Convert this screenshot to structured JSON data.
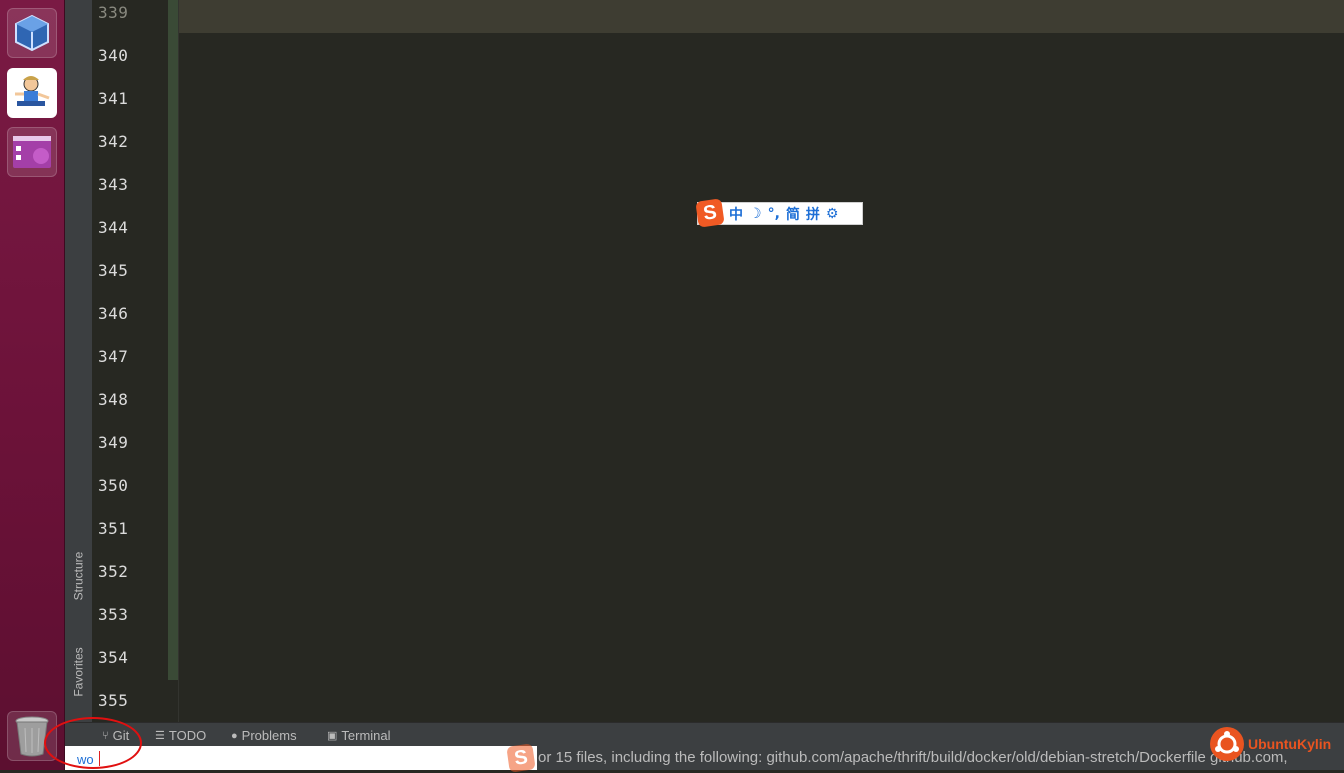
{
  "launcher": {
    "items": [
      {
        "name": "virtualbox",
        "icon": "virtualbox-cube-icon"
      },
      {
        "name": "cartoon-app",
        "icon": "cartoon-character-icon"
      },
      {
        "name": "workspace-switcher",
        "icon": "workspace-icon"
      },
      {
        "name": "trash",
        "icon": "trash-icon"
      }
    ]
  },
  "tool_strip": {
    "structure_label": "Structure",
    "favorites_label": "Favorites"
  },
  "editor": {
    "line_numbers": [
      "339",
      "340",
      "341",
      "342",
      "343",
      "344",
      "345",
      "346",
      "347",
      "348",
      "349",
      "350",
      "351",
      "352",
      "353",
      "354",
      "355"
    ]
  },
  "ime_toolbar": {
    "logo": "S",
    "items": [
      "中",
      "☽",
      "°,",
      "简",
      "拼",
      "⚙"
    ]
  },
  "bottom_tabs": {
    "git": "Git",
    "todo": "TODO",
    "problems": "Problems",
    "terminal": "Terminal"
  },
  "ime_composition": {
    "text": "wo"
  },
  "status": {
    "message": "or 15 files, including the following: github.com/apache/thrift/build/docker/old/debian-stretch/Dockerfile github.com,"
  },
  "watermark": {
    "text": "UbuntuKylin"
  },
  "colors": {
    "editor_bg": "#272822",
    "launcher_bg": "#6c1239",
    "accent_orange": "#e95420",
    "ime_blue": "#1d6fd6",
    "annotation_red": "#e01010"
  }
}
